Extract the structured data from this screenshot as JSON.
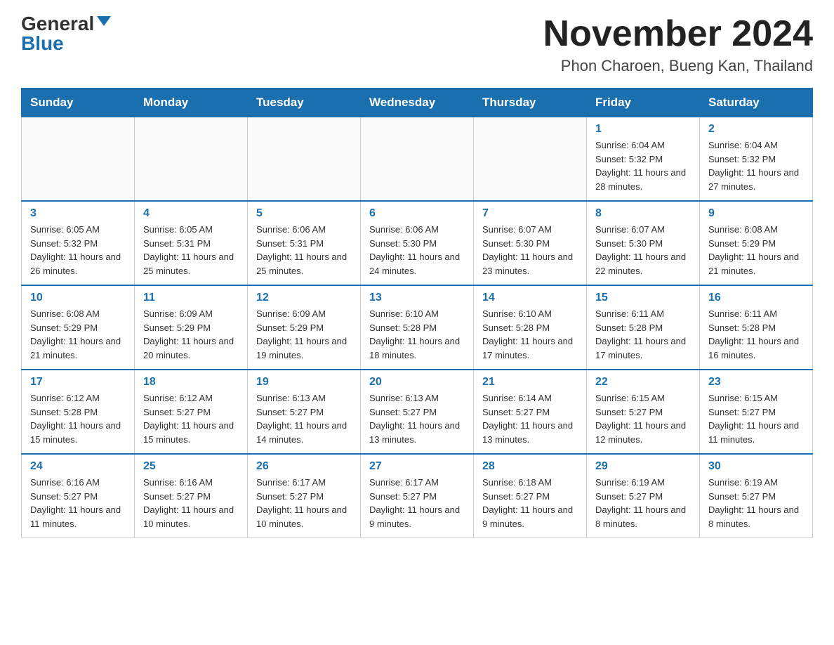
{
  "logo": {
    "general": "General",
    "blue": "Blue"
  },
  "title": "November 2024",
  "subtitle": "Phon Charoen, Bueng Kan, Thailand",
  "days_of_week": [
    "Sunday",
    "Monday",
    "Tuesday",
    "Wednesday",
    "Thursday",
    "Friday",
    "Saturday"
  ],
  "weeks": [
    [
      {
        "day": "",
        "info": ""
      },
      {
        "day": "",
        "info": ""
      },
      {
        "day": "",
        "info": ""
      },
      {
        "day": "",
        "info": ""
      },
      {
        "day": "",
        "info": ""
      },
      {
        "day": "1",
        "info": "Sunrise: 6:04 AM\nSunset: 5:32 PM\nDaylight: 11 hours and 28 minutes."
      },
      {
        "day": "2",
        "info": "Sunrise: 6:04 AM\nSunset: 5:32 PM\nDaylight: 11 hours and 27 minutes."
      }
    ],
    [
      {
        "day": "3",
        "info": "Sunrise: 6:05 AM\nSunset: 5:32 PM\nDaylight: 11 hours and 26 minutes."
      },
      {
        "day": "4",
        "info": "Sunrise: 6:05 AM\nSunset: 5:31 PM\nDaylight: 11 hours and 25 minutes."
      },
      {
        "day": "5",
        "info": "Sunrise: 6:06 AM\nSunset: 5:31 PM\nDaylight: 11 hours and 25 minutes."
      },
      {
        "day": "6",
        "info": "Sunrise: 6:06 AM\nSunset: 5:30 PM\nDaylight: 11 hours and 24 minutes."
      },
      {
        "day": "7",
        "info": "Sunrise: 6:07 AM\nSunset: 5:30 PM\nDaylight: 11 hours and 23 minutes."
      },
      {
        "day": "8",
        "info": "Sunrise: 6:07 AM\nSunset: 5:30 PM\nDaylight: 11 hours and 22 minutes."
      },
      {
        "day": "9",
        "info": "Sunrise: 6:08 AM\nSunset: 5:29 PM\nDaylight: 11 hours and 21 minutes."
      }
    ],
    [
      {
        "day": "10",
        "info": "Sunrise: 6:08 AM\nSunset: 5:29 PM\nDaylight: 11 hours and 21 minutes."
      },
      {
        "day": "11",
        "info": "Sunrise: 6:09 AM\nSunset: 5:29 PM\nDaylight: 11 hours and 20 minutes."
      },
      {
        "day": "12",
        "info": "Sunrise: 6:09 AM\nSunset: 5:29 PM\nDaylight: 11 hours and 19 minutes."
      },
      {
        "day": "13",
        "info": "Sunrise: 6:10 AM\nSunset: 5:28 PM\nDaylight: 11 hours and 18 minutes."
      },
      {
        "day": "14",
        "info": "Sunrise: 6:10 AM\nSunset: 5:28 PM\nDaylight: 11 hours and 17 minutes."
      },
      {
        "day": "15",
        "info": "Sunrise: 6:11 AM\nSunset: 5:28 PM\nDaylight: 11 hours and 17 minutes."
      },
      {
        "day": "16",
        "info": "Sunrise: 6:11 AM\nSunset: 5:28 PM\nDaylight: 11 hours and 16 minutes."
      }
    ],
    [
      {
        "day": "17",
        "info": "Sunrise: 6:12 AM\nSunset: 5:28 PM\nDaylight: 11 hours and 15 minutes."
      },
      {
        "day": "18",
        "info": "Sunrise: 6:12 AM\nSunset: 5:27 PM\nDaylight: 11 hours and 15 minutes."
      },
      {
        "day": "19",
        "info": "Sunrise: 6:13 AM\nSunset: 5:27 PM\nDaylight: 11 hours and 14 minutes."
      },
      {
        "day": "20",
        "info": "Sunrise: 6:13 AM\nSunset: 5:27 PM\nDaylight: 11 hours and 13 minutes."
      },
      {
        "day": "21",
        "info": "Sunrise: 6:14 AM\nSunset: 5:27 PM\nDaylight: 11 hours and 13 minutes."
      },
      {
        "day": "22",
        "info": "Sunrise: 6:15 AM\nSunset: 5:27 PM\nDaylight: 11 hours and 12 minutes."
      },
      {
        "day": "23",
        "info": "Sunrise: 6:15 AM\nSunset: 5:27 PM\nDaylight: 11 hours and 11 minutes."
      }
    ],
    [
      {
        "day": "24",
        "info": "Sunrise: 6:16 AM\nSunset: 5:27 PM\nDaylight: 11 hours and 11 minutes."
      },
      {
        "day": "25",
        "info": "Sunrise: 6:16 AM\nSunset: 5:27 PM\nDaylight: 11 hours and 10 minutes."
      },
      {
        "day": "26",
        "info": "Sunrise: 6:17 AM\nSunset: 5:27 PM\nDaylight: 11 hours and 10 minutes."
      },
      {
        "day": "27",
        "info": "Sunrise: 6:17 AM\nSunset: 5:27 PM\nDaylight: 11 hours and 9 minutes."
      },
      {
        "day": "28",
        "info": "Sunrise: 6:18 AM\nSunset: 5:27 PM\nDaylight: 11 hours and 9 minutes."
      },
      {
        "day": "29",
        "info": "Sunrise: 6:19 AM\nSunset: 5:27 PM\nDaylight: 11 hours and 8 minutes."
      },
      {
        "day": "30",
        "info": "Sunrise: 6:19 AM\nSunset: 5:27 PM\nDaylight: 11 hours and 8 minutes."
      }
    ]
  ]
}
